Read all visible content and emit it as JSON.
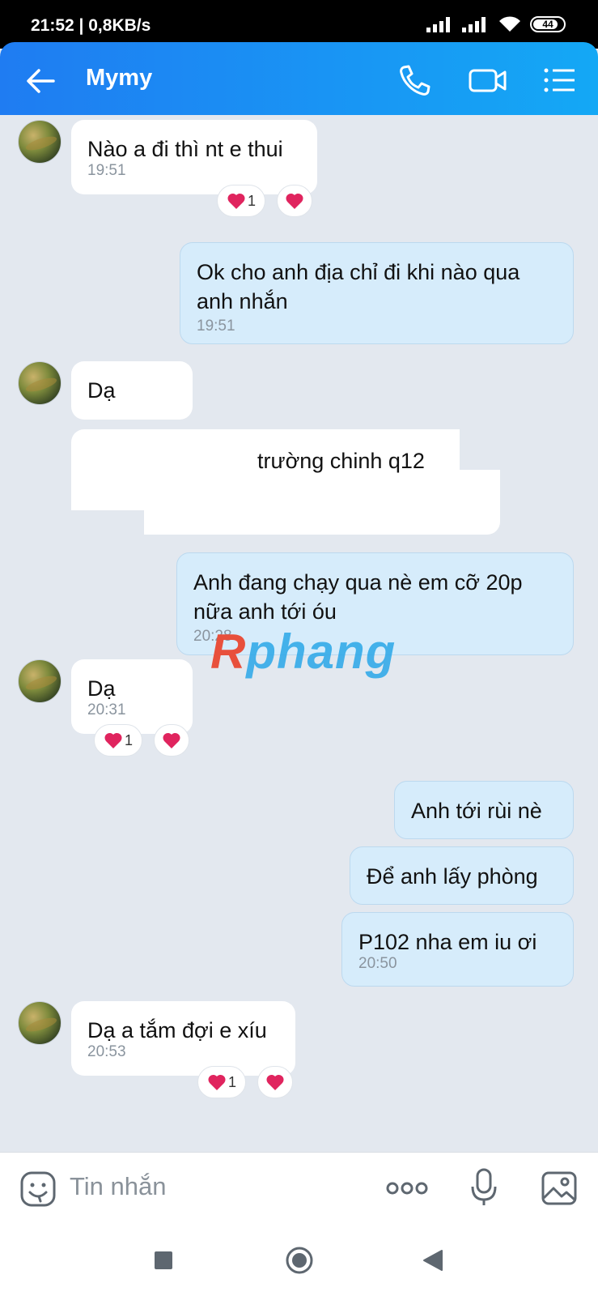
{
  "status": {
    "time": "21:52 | 0,8KB/s",
    "battery": "44"
  },
  "header": {
    "title": "Mymy"
  },
  "messages": [
    {
      "text": "Nào a đi thì nt e thui",
      "time": "19:51",
      "reaction_count": "1"
    },
    {
      "text": "Ok cho anh địa chỉ đi khi nào qua anh nhắn",
      "time": "19:51"
    },
    {
      "text": "Dạ"
    },
    {
      "text": "trường chinh q12"
    },
    {
      "text": "Anh đang chạy qua nè em cỡ 20p nữa anh tới óu",
      "time": "20:28"
    },
    {
      "text": "Dạ",
      "time": "20:31",
      "reaction_count": "1"
    },
    {
      "text": "Anh tới rùi nè"
    },
    {
      "text": "Để anh lấy phòng"
    },
    {
      "text": "P102 nha em iu ơi",
      "time": "20:50"
    },
    {
      "text": "Dạ a tắm đợi e xíu",
      "time": "20:53",
      "reaction_count": "1"
    }
  ],
  "watermark": {
    "first": "R",
    "rest": "phang"
  },
  "input": {
    "placeholder": "Tin nhắn"
  },
  "colors": {
    "header_start": "#1f7cf2",
    "header_end": "#14a8f5",
    "outgoing_bubble": "#d6ecfb",
    "incoming_bubble": "#ffffff",
    "chat_bg": "#e3e8ef",
    "heart": "#e0245e"
  },
  "icons": [
    "back-arrow-icon",
    "phone-icon",
    "video-call-icon",
    "menu-list-icon",
    "sticker-icon",
    "more-icon",
    "microphone-icon",
    "image-icon",
    "heart-icon",
    "nav-square-icon",
    "nav-circle-icon",
    "nav-back-icon"
  ]
}
